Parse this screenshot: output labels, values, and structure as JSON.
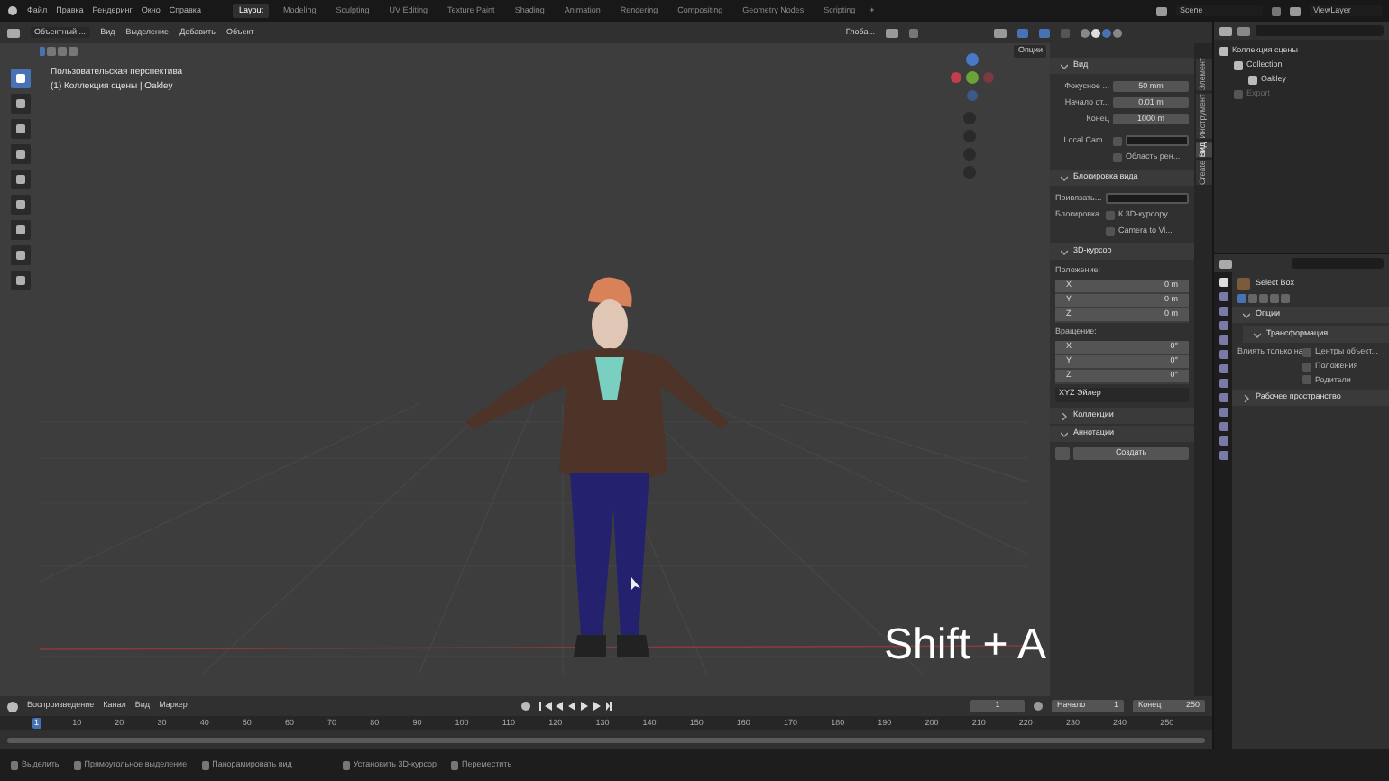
{
  "top_menu": [
    "Файл",
    "Правка",
    "Рендеринг",
    "Окно",
    "Справка"
  ],
  "workspaces": [
    {
      "label": "Layout",
      "selected": true
    },
    {
      "label": "Modeling",
      "selected": false
    },
    {
      "label": "Sculpting",
      "selected": false
    },
    {
      "label": "UV Editing",
      "selected": false
    },
    {
      "label": "Texture Paint",
      "selected": false
    },
    {
      "label": "Shading",
      "selected": false
    },
    {
      "label": "Animation",
      "selected": false
    },
    {
      "label": "Rendering",
      "selected": false
    },
    {
      "label": "Compositing",
      "selected": false
    },
    {
      "label": "Geometry Nodes",
      "selected": false
    },
    {
      "label": "Scripting",
      "selected": false
    }
  ],
  "add_workspace": "+",
  "scene": "Scene",
  "view_layer": "ViewLayer",
  "header": {
    "mode": "Объектный ...",
    "menus": [
      "Вид",
      "Выделение",
      "Добавить",
      "Объект"
    ],
    "transform": "Глоба...",
    "options": "Опции"
  },
  "viewport": {
    "view_name": "Пользовательская перспектива",
    "collection_info": "(1) Коллекция сцены | Oakley",
    "overlay_text": "Shift + A"
  },
  "sidebar": {
    "tabs": [
      {
        "label": "Элемент",
        "selected": false
      },
      {
        "label": "Инструмент",
        "selected": false
      },
      {
        "label": "Вид",
        "selected": true
      },
      {
        "label": "Create",
        "selected": false
      }
    ],
    "view": {
      "title": "Вид",
      "fields": [
        {
          "label": "Фокусное ...",
          "value": "50 mm"
        },
        {
          "label": "Начало от...",
          "value": "0.01 m"
        },
        {
          "label": "Конец",
          "value": "1000 m"
        }
      ],
      "local_camera": {
        "label": "Local Cam...",
        "checked": false
      },
      "render_region": {
        "label": "Область рен...",
        "checked": false
      },
      "lock": {
        "title": "Блокировка вида",
        "bind_label": "Привязать...",
        "lock_label": "Блокировка",
        "options": [
          {
            "label": "К 3D-курсору",
            "checked": false
          },
          {
            "label": "Camera to Vi...",
            "checked": false
          }
        ]
      }
    },
    "cursor": {
      "title": "3D-курсор",
      "location_label": "Положение:",
      "location": [
        {
          "axis": "X",
          "value": "0 m"
        },
        {
          "axis": "Y",
          "value": "0 m"
        },
        {
          "axis": "Z",
          "value": "0 m"
        }
      ],
      "rotation_label": "Вращение:",
      "rotation": [
        {
          "axis": "X",
          "value": "0°"
        },
        {
          "axis": "Y",
          "value": "0°"
        },
        {
          "axis": "Z",
          "value": "0°"
        }
      ],
      "rotation_mode": "XYZ Эйлер"
    },
    "collections": "Коллекции",
    "annotations": {
      "title": "Аннотации",
      "button": "Создать"
    }
  },
  "outliner": {
    "items": [
      {
        "label": "Коллекция сцены",
        "excluded": false,
        "children": [
          {
            "label": "Collection",
            "excluded": false,
            "children": [
              {
                "label": "Oakley",
                "excluded": false
              }
            ]
          },
          {
            "label": "Export",
            "excluded": true
          }
        ]
      }
    ]
  },
  "properties": {
    "tool": "Select Box",
    "options": "Опции",
    "transform": "Трансформация",
    "affect_label": "Влиять только на",
    "affect": [
      {
        "label": "Центры объект...",
        "checked": false
      },
      {
        "label": "Положения",
        "checked": false
      },
      {
        "label": "Родители",
        "checked": false
      }
    ],
    "workspace": "Рабочее пространство"
  },
  "timeline": {
    "menus": [
      "Воспроизведение",
      "Канал",
      "Вид",
      "Маркер"
    ],
    "current_frame": "1",
    "start_label": "Начало",
    "start": "1",
    "end_label": "Конец",
    "end": "250",
    "ticks": [
      {
        "label": "1",
        "selected": true
      },
      {
        "label": "10",
        "selected": false
      },
      {
        "label": "20",
        "selected": false
      },
      {
        "label": "30",
        "selected": false
      },
      {
        "label": "40",
        "selected": false
      },
      {
        "label": "50",
        "selected": false
      },
      {
        "label": "60",
        "selected": false
      },
      {
        "label": "70",
        "selected": false
      },
      {
        "label": "80",
        "selected": false
      },
      {
        "label": "90",
        "selected": false
      },
      {
        "label": "100",
        "selected": false
      },
      {
        "label": "110",
        "selected": false
      },
      {
        "label": "120",
        "selected": false
      },
      {
        "label": "130",
        "selected": false
      },
      {
        "label": "140",
        "selected": false
      },
      {
        "label": "150",
        "selected": false
      },
      {
        "label": "160",
        "selected": false
      },
      {
        "label": "170",
        "selected": false
      },
      {
        "label": "180",
        "selected": false
      },
      {
        "label": "190",
        "selected": false
      },
      {
        "label": "200",
        "selected": false
      },
      {
        "label": "210",
        "selected": false
      },
      {
        "label": "220",
        "selected": false
      },
      {
        "label": "230",
        "selected": false
      },
      {
        "label": "240",
        "selected": false
      },
      {
        "label": "250",
        "selected": false
      }
    ]
  },
  "status_bar": [
    "Выделить",
    "Прямоугольное выделение",
    "Панорамировать вид",
    "Установить 3D-курсор",
    "Переместить"
  ]
}
